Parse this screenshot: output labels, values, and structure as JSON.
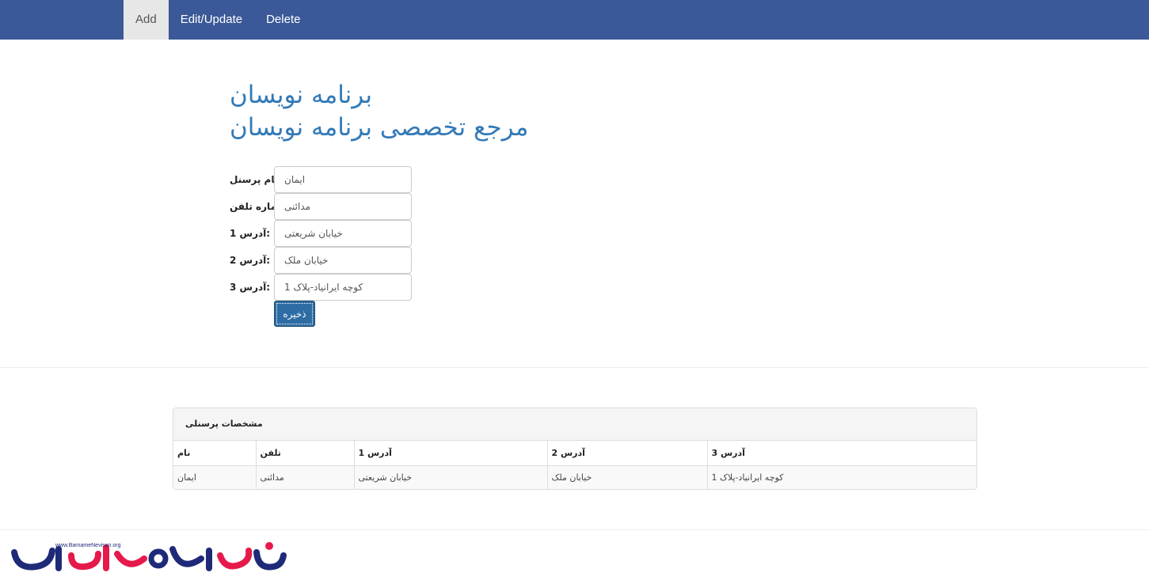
{
  "nav": {
    "tabs": [
      {
        "label": "Add",
        "active": true
      },
      {
        "label": "Edit/Update",
        "active": false
      },
      {
        "label": "Delete",
        "active": false
      }
    ]
  },
  "heading": {
    "line1": "برنامه نویسان",
    "line2": "مرجع تخصصی برنامه نویسان"
  },
  "form": {
    "fields": [
      {
        "label": ":نام پرسنل",
        "value": "ایمان"
      },
      {
        "label": ":شماره تلفن",
        "value": "مدائنی"
      },
      {
        "label": ":آدرس 1",
        "value": "خیابان شریعتی"
      },
      {
        "label": ":آدرس 2",
        "value": "خیابان ملک"
      },
      {
        "label": ":آدرس 3",
        "value": "کوچه ایرانیاد-پلاک 1"
      }
    ],
    "save_label": "ذخیره"
  },
  "panel": {
    "title": "مشخصات پرسنلی",
    "columns": [
      "نام",
      "تلفن",
      "آدرس 1",
      "آدرس 2",
      "آدرس 3"
    ],
    "rows": [
      [
        "ایمان",
        "مدائنی",
        "خیابان شریعتی",
        "خیابان ملک",
        "کوچه ایرانیاد-پلاک 1"
      ]
    ]
  },
  "colors": {
    "navbar": "#3b5998",
    "heading": "#337ab7",
    "button": "#2e6da4",
    "logo_red": "#e6194b",
    "logo_blue": "#1e2a78"
  },
  "logo": {
    "url_text": "www.BarnameNevisan.org",
    "icon": "barnamenevisan-logo-icon"
  }
}
